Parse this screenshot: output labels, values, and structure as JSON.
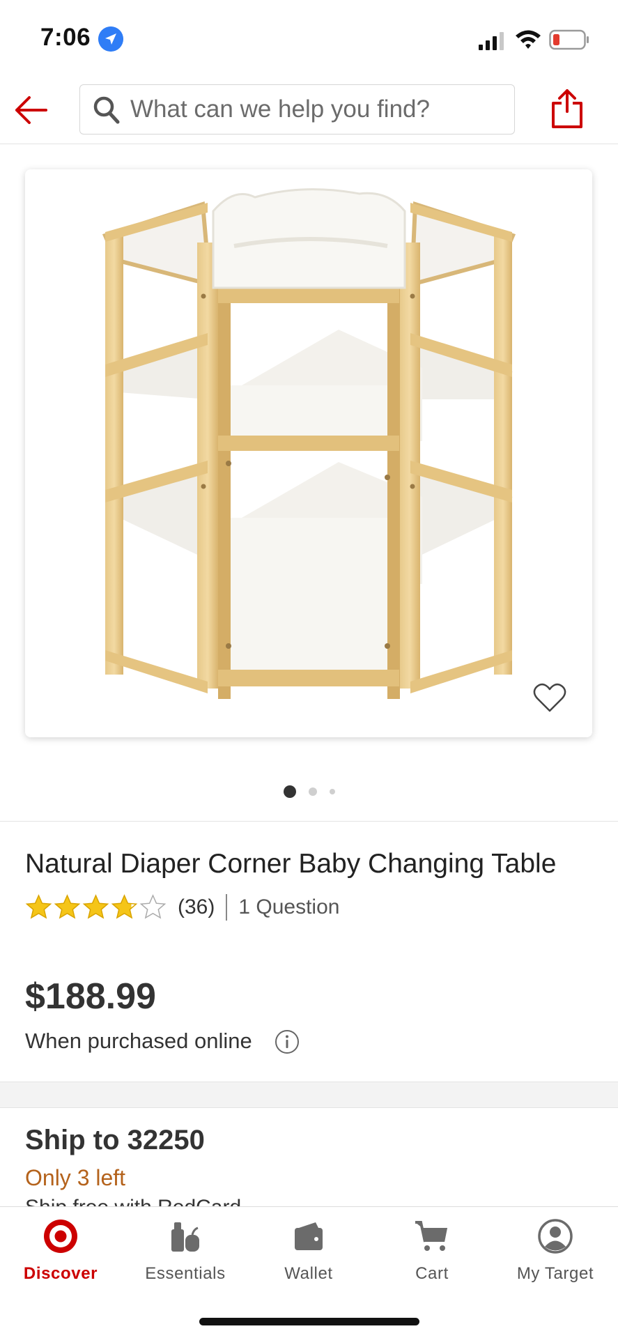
{
  "status_bar": {
    "time": "7:06",
    "icons": [
      "location-arrow-icon",
      "cellular-signal-icon",
      "wifi-icon",
      "battery-low-icon"
    ],
    "battery_color": "#e33b2e"
  },
  "header": {
    "search_placeholder": "What can we help you find?",
    "icons": [
      "back-arrow-icon",
      "search-icon",
      "share-icon"
    ],
    "accent_color": "#cc0000"
  },
  "gallery": {
    "image_alt": "Natural Diaper Corner Baby Changing Table",
    "image_count": 3,
    "active_index": 0,
    "favorite_icon": "heart-outline-icon"
  },
  "product": {
    "title": "Natural Diaper Corner Baby Changing Table",
    "rating": 3.8,
    "rating_max": 5,
    "review_count": "(36)",
    "questions": "1 Question",
    "star_color": "#f5c518"
  },
  "pricing": {
    "price": "$188.99",
    "note": "When purchased online",
    "info_icon": "info-circle-icon"
  },
  "fulfillment": {
    "ship_title": "Ship to 32250",
    "stock": "Only 3 left",
    "partial_line": "Ship free with RedCard"
  },
  "bottom_nav": {
    "items": [
      {
        "label": "Discover",
        "icon": "target-logo-icon",
        "active": true
      },
      {
        "label": "Essentials",
        "icon": "essentials-icon",
        "active": false
      },
      {
        "label": "Wallet",
        "icon": "wallet-icon",
        "active": false
      },
      {
        "label": "Cart",
        "icon": "cart-icon",
        "active": false
      },
      {
        "label": "My Target",
        "icon": "profile-icon",
        "active": false
      }
    ]
  }
}
